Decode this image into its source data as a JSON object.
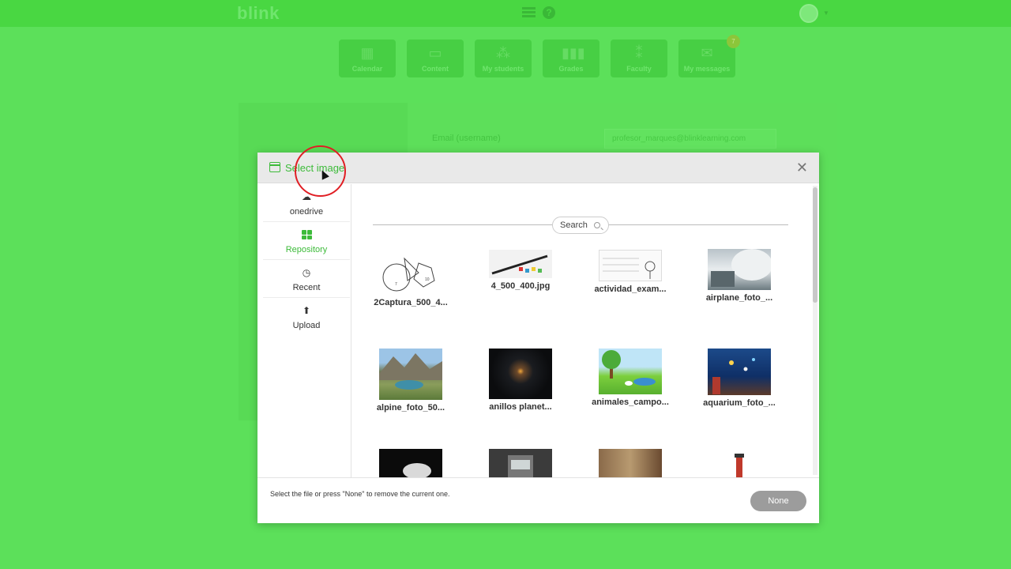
{
  "app": {
    "logo": "blink"
  },
  "nav": [
    {
      "label": "Calendar",
      "icon": "calendar-icon"
    },
    {
      "label": "Content",
      "icon": "content-icon"
    },
    {
      "label": "My students",
      "icon": "students-icon"
    },
    {
      "label": "Grades",
      "icon": "grades-icon"
    },
    {
      "label": "Faculty",
      "icon": "faculty-icon"
    },
    {
      "label": "My messages",
      "icon": "mail-icon",
      "badge": "7"
    }
  ],
  "background_form": {
    "email_label": "Email (username)",
    "email_value": "profesor_marques@blinklearning.com"
  },
  "modal": {
    "title": "Select image",
    "sidebar": [
      {
        "label": "onedrive",
        "icon": "cloud-icon"
      },
      {
        "label": "Repository",
        "icon": "grid-icon",
        "active": true
      },
      {
        "label": "Recent",
        "icon": "clock-icon"
      },
      {
        "label": "Upload",
        "icon": "upload-arrow-icon"
      }
    ],
    "search_placeholder": "Search",
    "images": [
      "2Captura_500_4...",
      "4_500_400.jpg",
      "actividad_exam...",
      "airplane_foto_...",
      "alpine_foto_50...",
      "anillos planet...",
      "animales_campo...",
      "aquarium_foto_..."
    ],
    "footer_text": "Select the file or press \"None\" to remove the current one.",
    "none_label": "None"
  },
  "colors": {
    "background": "#5ce05a",
    "accent": "#3dbb3a",
    "highlight_circle": "#e01e24"
  }
}
